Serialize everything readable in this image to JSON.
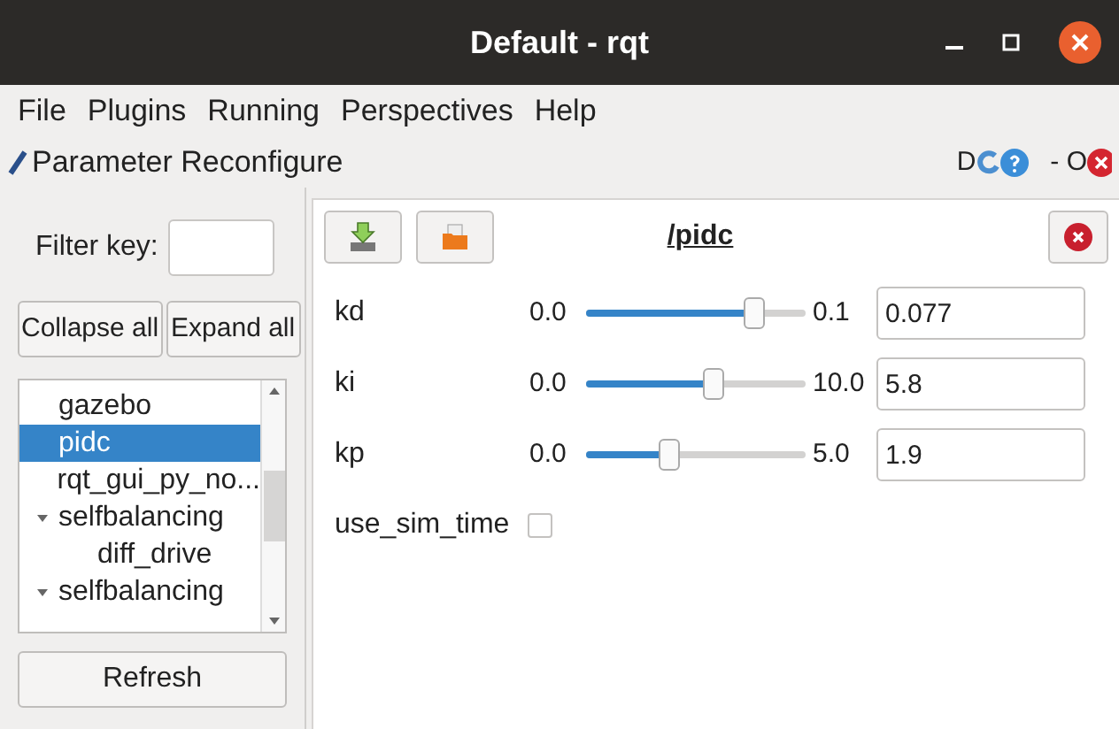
{
  "window": {
    "title": "Default - rqt"
  },
  "menu": [
    "File",
    "Plugins",
    "Running",
    "Perspectives",
    "Help"
  ],
  "plugin": {
    "title": "Parameter Reconfigure",
    "corner_letters": [
      "D",
      "- O"
    ]
  },
  "sidebar": {
    "filter_label": "Filter key:",
    "collapse_button": "Collapse all",
    "expand_button": "Expand all",
    "refresh_button": "Refresh",
    "tree": [
      {
        "label": "gazebo",
        "selected": false
      },
      {
        "label": "pidc",
        "selected": true
      },
      {
        "label": "rqt_gui_py_no...",
        "selected": false
      },
      {
        "label": "selfbalancing",
        "selected": false,
        "expanded": true,
        "children": [
          {
            "label": "diff_drive",
            "selected": false
          }
        ]
      },
      {
        "label": "selfbalancing",
        "selected": false,
        "expanded": true
      }
    ]
  },
  "node": {
    "title": "/pidc",
    "params": [
      {
        "kind": "slider",
        "name": "kd",
        "min": "0.0",
        "max": "0.1",
        "level": 0.77,
        "value": "0.077"
      },
      {
        "kind": "slider",
        "name": "ki",
        "min": "0.0",
        "max": "10.0",
        "level": 0.58,
        "value": "5.8"
      },
      {
        "kind": "slider",
        "name": "kp",
        "min": "0.0",
        "max": "5.0",
        "level": 0.38,
        "value": "1.9"
      },
      {
        "kind": "checkbox",
        "name": "use_sim_time",
        "checked": false
      }
    ]
  }
}
